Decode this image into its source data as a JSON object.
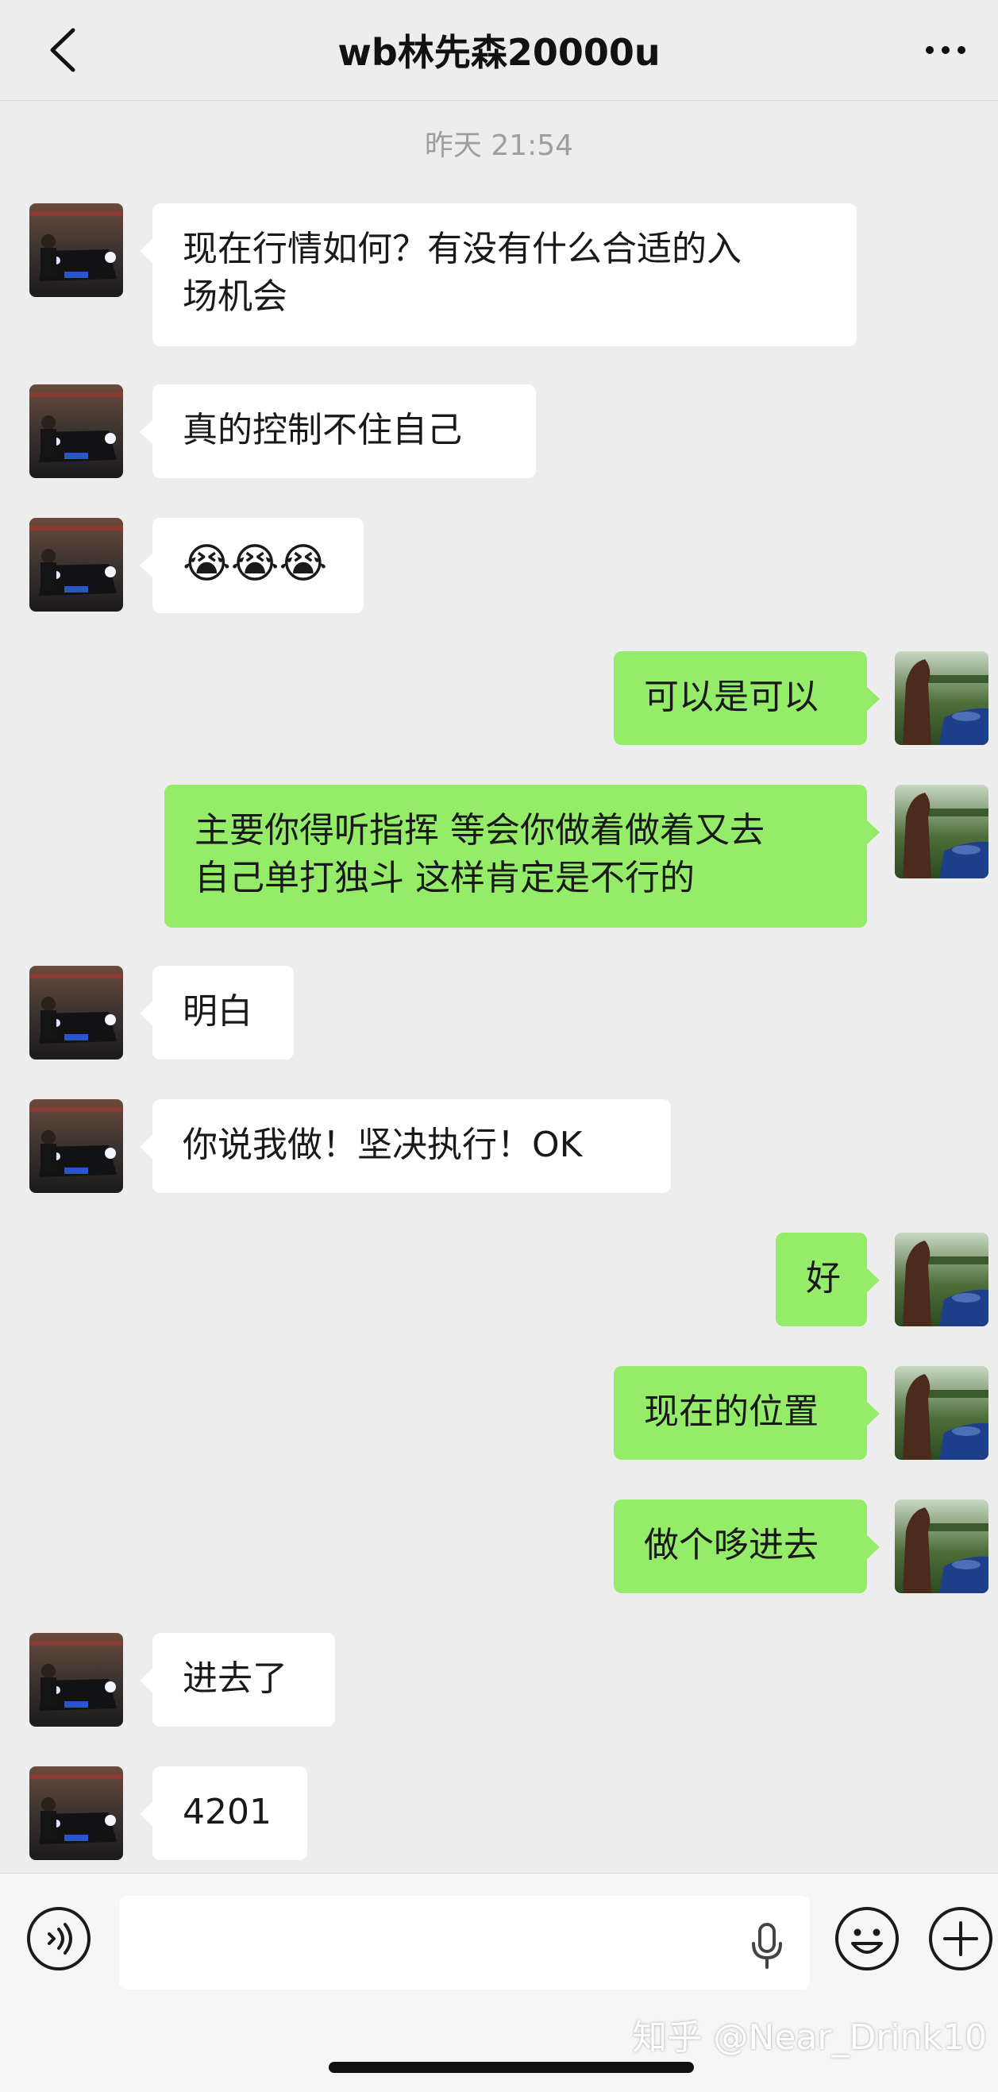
{
  "header": {
    "back_icon": "chevron-left-icon",
    "title": "wb林先森20000u",
    "more_icon": "more-dots-icon"
  },
  "timestamp": "昨天 21:54",
  "messages": [
    {
      "side": "in",
      "text": "现在行情如何？有没有什么合适的入\n场机会"
    },
    {
      "side": "in",
      "text": "真的控制不住自己"
    },
    {
      "side": "in",
      "text": "😭😭😭"
    },
    {
      "side": "out",
      "text": "可以是可以"
    },
    {
      "side": "out",
      "text": "主要你得听指挥 等会你做着做着又去\n自己单打独斗 这样肯定是不行的"
    },
    {
      "side": "in",
      "text": "明白"
    },
    {
      "side": "in",
      "text": "你说我做！坚决执行！OK"
    },
    {
      "side": "out",
      "text": "好"
    },
    {
      "side": "out",
      "text": "现在的位置"
    },
    {
      "side": "out",
      "text": "做个哆进去"
    },
    {
      "side": "in",
      "text": "进去了"
    },
    {
      "side": "in",
      "text": "4201"
    }
  ],
  "input_bar": {
    "voice_icon": "voice-icon",
    "input_value": "",
    "mic_icon": "microphone-icon",
    "emoji_icon": "emoji-icon",
    "plus_icon": "plus-icon"
  },
  "watermark": "知乎 @Near_Drink10",
  "colors": {
    "background": "#ededed",
    "incoming_bubble": "#ffffff",
    "outgoing_bubble": "#95ec69"
  }
}
